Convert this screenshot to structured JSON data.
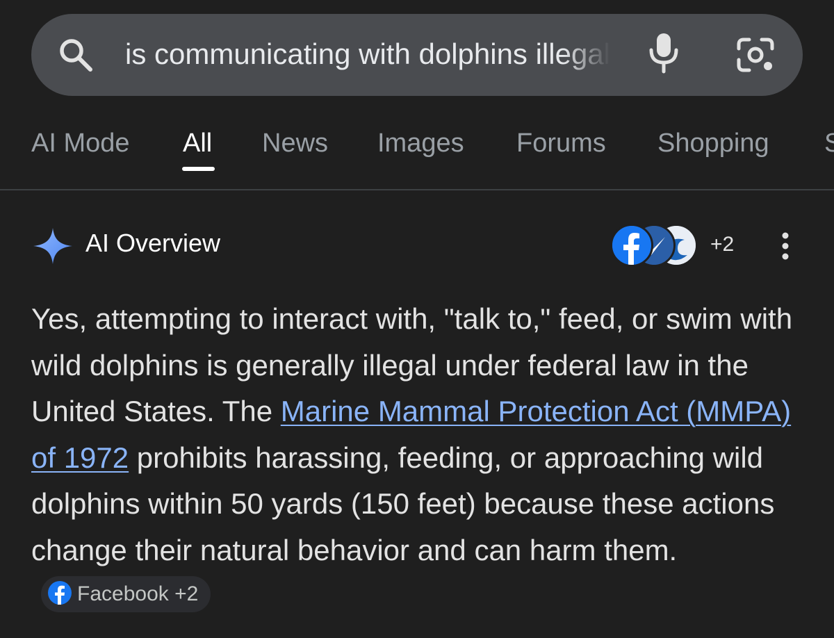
{
  "search": {
    "query": "is communicating with dolphins illegal"
  },
  "tabs": [
    {
      "label": "AI Mode"
    },
    {
      "label": "All"
    },
    {
      "label": "News"
    },
    {
      "label": "Images"
    },
    {
      "label": "Forums"
    },
    {
      "label": "Shopping"
    },
    {
      "label": "S"
    }
  ],
  "active_tab": "All",
  "overview": {
    "title": "AI Overview",
    "sources_more": "+2",
    "text_1": "Yes, attempting to interact with, \"talk to,\" feed, or swim with wild dolphins is generally illegal under federal law in the United States. The ",
    "link": "Marine Mammal Protection Act (MMPA) of 1972",
    "text_2": " prohibits harassing, feeding, or approaching wild dolphins within 50 yards (150 feet) because these actions change their natural behavior and can harm them.",
    "citation": "Facebook +2"
  },
  "colors": {
    "background": "#1f1f1f",
    "search_bar": "#4a4c50",
    "link": "#8ab4f8",
    "spark": "#6fa3f7",
    "facebook": "#1877f2"
  },
  "icons": [
    "search-icon",
    "mic-icon",
    "lens-icon",
    "ai-sparkle-icon",
    "facebook-icon",
    "more-vert-icon"
  ]
}
